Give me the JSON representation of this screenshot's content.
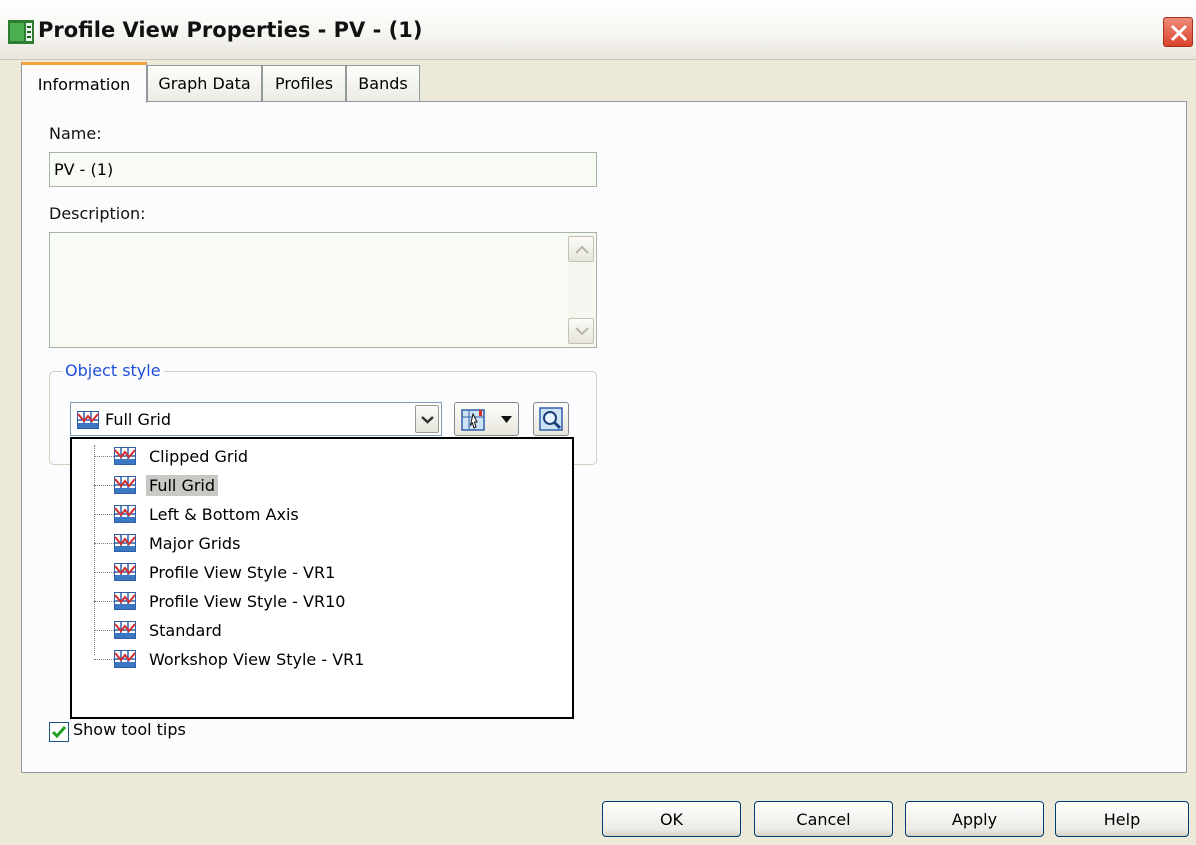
{
  "window": {
    "title": "Profile View Properties - PV - (1)"
  },
  "tabs": [
    {
      "label": "Information",
      "active": true
    },
    {
      "label": "Graph Data",
      "active": false
    },
    {
      "label": "Profiles",
      "active": false
    },
    {
      "label": "Bands",
      "active": false
    }
  ],
  "information": {
    "name_label": "Name:",
    "name_value": "PV - (1)",
    "description_label": "Description:",
    "description_value": "",
    "object_style_legend": "Object style",
    "object_style_selected": "Full Grid",
    "style_options": [
      "Clipped Grid",
      "Full Grid",
      "Left & Bottom Axis",
      "Major Grids",
      "Profile View Style - VR1",
      "Profile View Style - VR10",
      "Standard",
      "Workshop View Style - VR1"
    ],
    "show_tooltips_label": "Show tool tips",
    "show_tooltips_checked": true
  },
  "buttons": {
    "ok": "OK",
    "cancel": "Cancel",
    "apply": "Apply",
    "help": "Help"
  },
  "icons": {
    "app": "profile-view-app-icon",
    "close": "close-icon",
    "style": "profile-view-style-icon",
    "edit_style": "edit-style-icon",
    "preview": "magnifier-icon"
  },
  "colors": {
    "tab_highlight": "#f2a43a",
    "legend_text": "#1d4fd8",
    "close_button": "#d9432c"
  }
}
